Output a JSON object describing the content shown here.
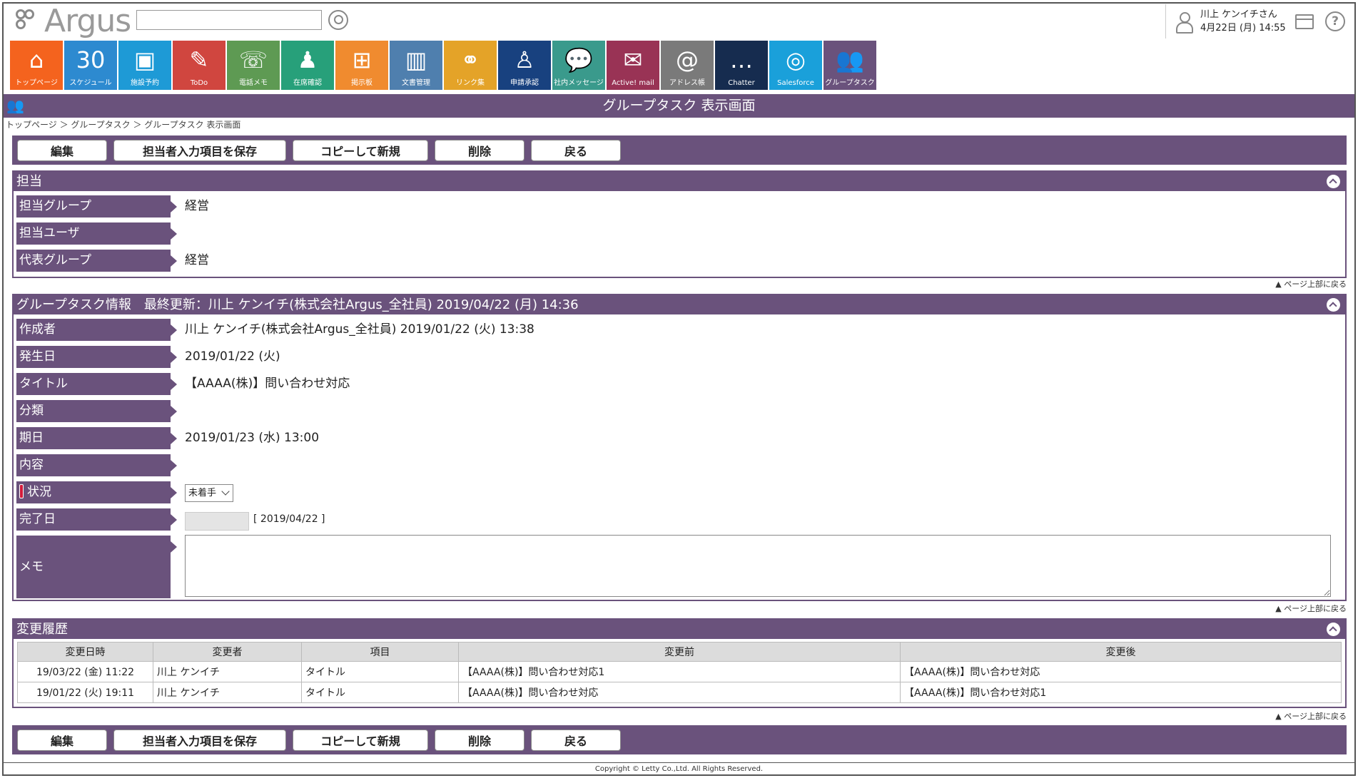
{
  "header": {
    "logo_text": "Argus",
    "search_placeholder": "",
    "user_name": "川上 ケンイチさん",
    "user_datetime": "4月22日 (月) 14:55",
    "help_glyph": "?"
  },
  "apps": [
    {
      "label": "トップページ",
      "color": "#f4631e",
      "icon": "⌂",
      "name": "home-icon"
    },
    {
      "label": "スケジュール",
      "color": "#2d8ad0",
      "icon": "30",
      "name": "calendar-icon"
    },
    {
      "label": "施設予約",
      "color": "#1e9ad6",
      "icon": "▣",
      "name": "facility-icon"
    },
    {
      "label": "ToDo",
      "color": "#d0463f",
      "icon": "✎",
      "name": "todo-icon"
    },
    {
      "label": "電話メモ",
      "color": "#5e9a53",
      "icon": "☏",
      "name": "phone-icon"
    },
    {
      "label": "在席確認",
      "color": "#27a07a",
      "icon": "♟",
      "name": "presence-icon"
    },
    {
      "label": "掲示板",
      "color": "#f08b2f",
      "icon": "⊞",
      "name": "board-icon"
    },
    {
      "label": "文書管理",
      "color": "#4f7fae",
      "icon": "▥",
      "name": "document-icon"
    },
    {
      "label": "リンク集",
      "color": "#e4a328",
      "icon": "⚭",
      "name": "link-icon"
    },
    {
      "label": "申請承認",
      "color": "#18417f",
      "icon": "♙",
      "name": "approval-icon"
    },
    {
      "label": "社内メッセージ",
      "color": "#3a9a8c",
      "icon": "💬",
      "name": "message-icon"
    },
    {
      "label": "Active! mail",
      "color": "#993355",
      "icon": "✉",
      "name": "mail-icon"
    },
    {
      "label": "アドレス帳",
      "color": "#7a7a7a",
      "icon": "@",
      "name": "address-icon"
    },
    {
      "label": "Chatter",
      "color": "#162c4f",
      "icon": "…",
      "name": "chatter-icon"
    },
    {
      "label": "Salesforce",
      "color": "#1aa0da",
      "icon": "◎",
      "name": "salesforce-icon"
    },
    {
      "label": "グループタスク",
      "color": "#6a527c",
      "icon": "👥",
      "name": "group-task-icon"
    }
  ],
  "page": {
    "title": "グループタスク 表示画面",
    "breadcrumb": "トップページ ＞ グループタスク ＞ グループタスク 表示画面",
    "back_to_top": "▲ ページ上部に戻る",
    "copyright": "Copyright © Letty Co.,Ltd. All Rights Reserved."
  },
  "buttons": {
    "edit": "編集",
    "save_assignee": "担当者入力項目を保存",
    "copy_new": "コピーして新規",
    "delete": "削除",
    "back": "戻る"
  },
  "assignee": {
    "heading": "担当",
    "group_label": "担当グループ",
    "group_value": "経営",
    "user_label": "担当ユーザ",
    "user_value": "",
    "rep_label": "代表グループ",
    "rep_value": "経営"
  },
  "info": {
    "heading": "グループタスク情報　最終更新：川上 ケンイチ(株式会社Argus_全社員) 2019/04/22 (月) 14:36",
    "creator_label": "作成者",
    "creator_value": "川上 ケンイチ(株式会社Argus_全社員) 2019/01/22 (火) 13:38",
    "date_label": "発生日",
    "date_value": "2019/01/22 (火)",
    "title_label": "タイトル",
    "title_value": "【AAAA(株)】問い合わせ対応",
    "category_label": "分類",
    "category_value": "",
    "due_label": "期日",
    "due_value": "2019/01/23 (水) 13:00",
    "content_label": "内容",
    "content_value": "",
    "status_label": "状況",
    "status_value": "未着手",
    "done_label": "完了日",
    "done_value": "",
    "done_suggest": "[ 2019/04/22 ]",
    "memo_label": "メモ",
    "memo_value": ""
  },
  "history": {
    "heading": "変更履歴",
    "columns": [
      "変更日時",
      "変更者",
      "項目",
      "変更前",
      "変更後"
    ],
    "rows": [
      [
        "19/03/22 (金) 11:22",
        "川上 ケンイチ",
        "タイトル",
        "【AAAA(株)】問い合わせ対応1",
        "【AAAA(株)】問い合わせ対応"
      ],
      [
        "19/01/22 (火) 19:11",
        "川上 ケンイチ",
        "タイトル",
        "【AAAA(株)】問い合わせ対応",
        "【AAAA(株)】問い合わせ対応1"
      ]
    ]
  }
}
